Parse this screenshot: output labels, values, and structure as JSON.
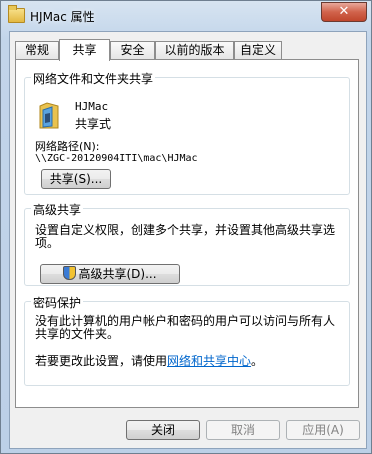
{
  "window": {
    "title": "HJMac 属性",
    "close_glyph": "✕"
  },
  "tabs": [
    {
      "label": "常规",
      "active": false
    },
    {
      "label": "共享",
      "active": true
    },
    {
      "label": "安全",
      "active": false
    },
    {
      "label": "以前的版本",
      "active": false
    },
    {
      "label": "自定义",
      "active": false
    }
  ],
  "network_share": {
    "group_title": "网络文件和文件夹共享",
    "share_name": "HJMac",
    "share_status": "共享式",
    "path_label": "网络路径(N):",
    "path_value": "\\\\ZGC-20120904ITI\\mac\\HJMac",
    "share_button": "共享(S)..."
  },
  "advanced_share": {
    "group_title": "高级共享",
    "description": "设置自定义权限，创建多个共享，并设置其他高级共享选项。",
    "button": "高级共享(D)..."
  },
  "password_protection": {
    "group_title": "密码保护",
    "description": "没有此计算机的用户帐户和密码的用户可以访问与所有人共享的文件夹。",
    "change_prefix": "若要更改此设置，请使用",
    "change_link": "网络和共享中心",
    "change_suffix": "。"
  },
  "footer": {
    "close": "关闭",
    "cancel": "取消",
    "apply": "应用(A)"
  },
  "icons": {
    "folder": "folder-icon",
    "shield": "uac-shield-icon",
    "app": "folder-icon"
  }
}
